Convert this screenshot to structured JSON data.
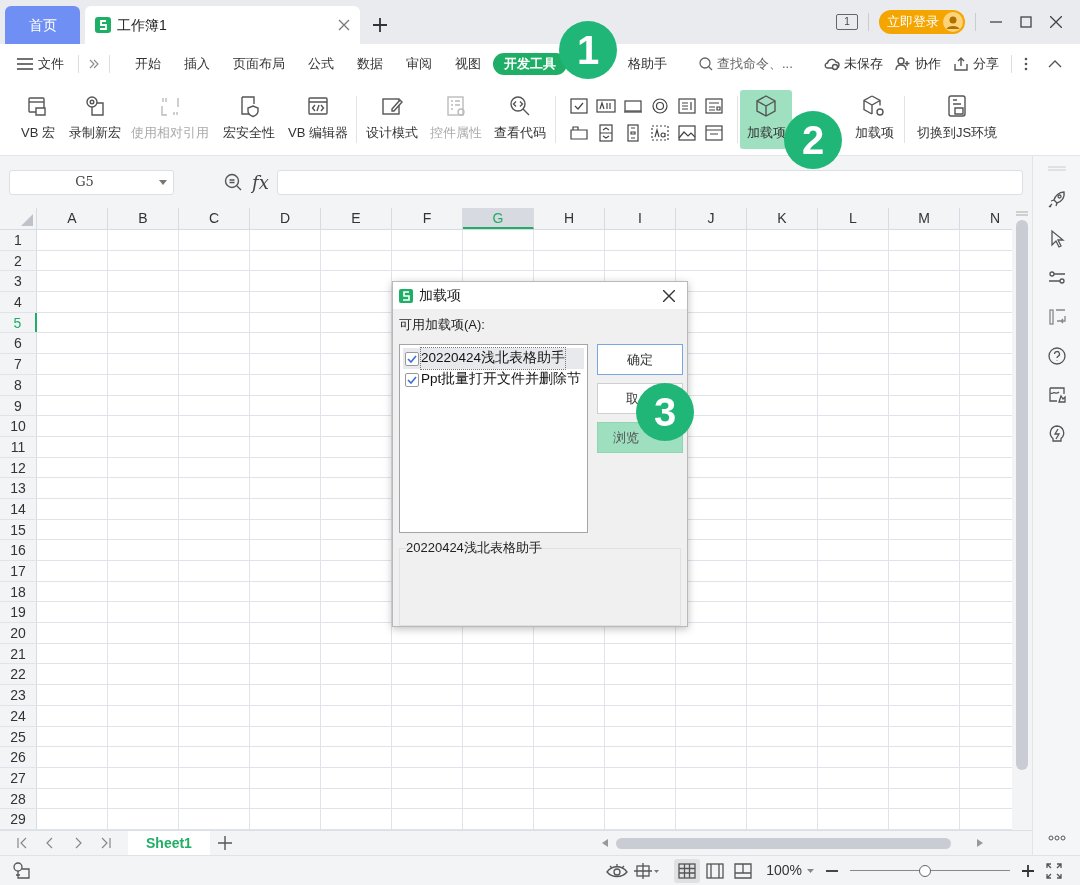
{
  "tabs": [
    {
      "label": "首页",
      "kind": "home",
      "selected": false
    },
    {
      "label": "工作簿1",
      "kind": "doc",
      "selected": true
    }
  ],
  "window_count": "1",
  "login_button": "立即登录",
  "menu": {
    "file": "文件",
    "items": [
      {
        "label": "开始",
        "selected": false
      },
      {
        "label": "插入",
        "selected": false
      },
      {
        "label": "页面布局",
        "selected": false
      },
      {
        "label": "公式",
        "selected": false
      },
      {
        "label": "数据",
        "selected": false
      },
      {
        "label": "审阅",
        "selected": false
      },
      {
        "label": "视图",
        "selected": false
      },
      {
        "label": "开发工具",
        "selected": true
      },
      {
        "label": "格助手",
        "selected": false
      }
    ],
    "search": {
      "placeholder": "查找命令、..."
    },
    "actions": [
      "未保存",
      "协作",
      "分享"
    ]
  },
  "ribbon": {
    "groups": [
      [
        {
          "label": "VB 宏",
          "disabled": false,
          "active": false
        },
        {
          "label": "录制新宏",
          "disabled": false,
          "active": false
        },
        {
          "label": "使用相对引用",
          "disabled": true,
          "active": false
        },
        {
          "label": "宏安全性",
          "disabled": false,
          "active": false
        },
        {
          "label": "VB 编辑器",
          "disabled": false,
          "active": false
        }
      ],
      [
        {
          "label": "设计模式",
          "disabled": false,
          "active": false
        },
        {
          "label": "控件属性",
          "disabled": true,
          "active": false
        },
        {
          "label": "查看代码",
          "disabled": false,
          "active": false
        }
      ],
      [
        {
          "label": "加载项",
          "disabled": false,
          "active": true
        },
        {
          "label": "加载项",
          "disabled": false,
          "active": false
        }
      ],
      [
        {
          "label": "切换到JS环境",
          "disabled": false,
          "active": false
        }
      ]
    ]
  },
  "name_box": "G5",
  "formula_label": "fx",
  "grid": {
    "columns": [
      {
        "label": "A",
        "selected": false
      },
      {
        "label": "B",
        "selected": false
      },
      {
        "label": "C",
        "selected": false
      },
      {
        "label": "D",
        "selected": false
      },
      {
        "label": "E",
        "selected": false
      },
      {
        "label": "F",
        "selected": false
      },
      {
        "label": "G",
        "selected": true
      },
      {
        "label": "H",
        "selected": false
      },
      {
        "label": "I",
        "selected": false
      },
      {
        "label": "J",
        "selected": false
      },
      {
        "label": "K",
        "selected": false
      },
      {
        "label": "L",
        "selected": false
      },
      {
        "label": "M",
        "selected": false
      },
      {
        "label": "N",
        "selected": false
      }
    ],
    "rows": [
      {
        "label": "1",
        "selected": false
      },
      {
        "label": "2",
        "selected": false
      },
      {
        "label": "3",
        "selected": false
      },
      {
        "label": "4",
        "selected": false
      },
      {
        "label": "5",
        "selected": true
      },
      {
        "label": "6",
        "selected": false
      },
      {
        "label": "7",
        "selected": false
      },
      {
        "label": "8",
        "selected": false
      },
      {
        "label": "9",
        "selected": false
      },
      {
        "label": "10",
        "selected": false
      },
      {
        "label": "11",
        "selected": false
      },
      {
        "label": "12",
        "selected": false
      },
      {
        "label": "13",
        "selected": false
      },
      {
        "label": "14",
        "selected": false
      },
      {
        "label": "15",
        "selected": false
      },
      {
        "label": "16",
        "selected": false
      },
      {
        "label": "17",
        "selected": false
      },
      {
        "label": "18",
        "selected": false
      },
      {
        "label": "19",
        "selected": false
      },
      {
        "label": "20",
        "selected": false
      },
      {
        "label": "21",
        "selected": false
      },
      {
        "label": "22",
        "selected": false
      },
      {
        "label": "23",
        "selected": false
      },
      {
        "label": "24",
        "selected": false
      },
      {
        "label": "25",
        "selected": false
      },
      {
        "label": "26",
        "selected": false
      },
      {
        "label": "27",
        "selected": false
      },
      {
        "label": "28",
        "selected": false
      },
      {
        "label": "29",
        "selected": false
      }
    ]
  },
  "sheet_tabs": [
    {
      "label": "Sheet1",
      "selected": true
    }
  ],
  "status": {
    "zoom": "100%",
    "level": 0.47
  },
  "dialog": {
    "title": "加载项",
    "list_label": "可用加载项(A):",
    "items": [
      {
        "label": "20220424浅北表格助手",
        "checked": true,
        "selected": true
      },
      {
        "label": "Ppt批量打开文件并删除节",
        "checked": true,
        "selected": false
      }
    ],
    "buttons": [
      {
        "label": "确定",
        "kind": "default"
      },
      {
        "label": "取",
        "kind": "normal"
      },
      {
        "label": "浏览",
        "kind": "primary"
      }
    ],
    "description": "20220424浅北表格助手"
  },
  "callouts": [
    "1",
    "2",
    "3"
  ]
}
